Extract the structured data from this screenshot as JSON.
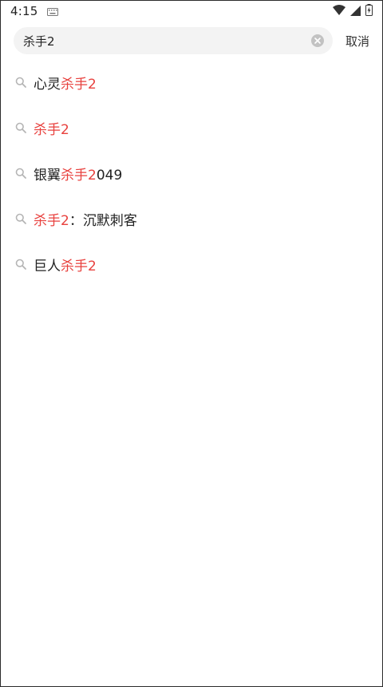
{
  "status_bar": {
    "time": "4:15",
    "icons": [
      "keyboard-icon",
      "wifi-icon",
      "signal-icon",
      "battery-icon"
    ]
  },
  "search": {
    "value": "杀手2",
    "cancel_label": "取消"
  },
  "colors": {
    "highlight": "#e8413e",
    "search_bg": "#f3f3f3",
    "text": "#222222"
  },
  "suggestions": [
    {
      "pre": "心灵",
      "match": "杀手2",
      "post": ""
    },
    {
      "pre": "",
      "match": "杀手2",
      "post": ""
    },
    {
      "pre": "银翼",
      "match": "杀手2",
      "post": "049"
    },
    {
      "pre": "",
      "match": "杀手2",
      "post": "：沉默刺客"
    },
    {
      "pre": "巨人",
      "match": "杀手2",
      "post": ""
    }
  ]
}
